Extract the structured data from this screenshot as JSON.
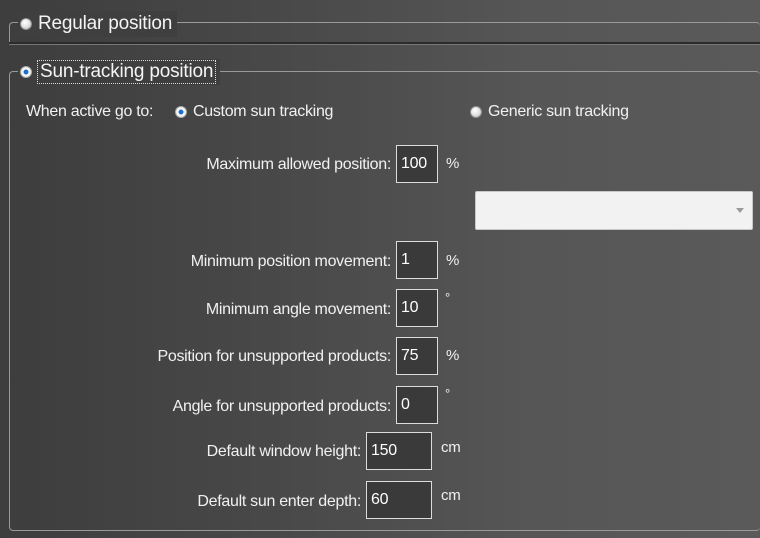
{
  "groups": {
    "regular": {
      "label": "Regular position",
      "selected": false
    },
    "sun": {
      "label": "Sun-tracking position",
      "selected": true
    }
  },
  "active_go_to": {
    "label": "When active go to:",
    "options": [
      {
        "label": "Custom sun tracking",
        "selected": true
      },
      {
        "label": "Generic sun tracking",
        "selected": false
      }
    ]
  },
  "fields": {
    "max_position": {
      "label": "Maximum allowed position:",
      "value": "100",
      "unit": "%"
    },
    "min_position_move": {
      "label": "Minimum position movement:",
      "value": "1",
      "unit": "%"
    },
    "min_angle_move": {
      "label": "Minimum angle movement:",
      "value": "10",
      "unit": "°"
    },
    "pos_unsupported": {
      "label": "Position for unsupported products:",
      "value": "75",
      "unit": "%"
    },
    "angle_unsupported": {
      "label": "Angle for unsupported products:",
      "value": "0",
      "unit": "°"
    },
    "window_height": {
      "label": "Default window height:",
      "value": "150",
      "unit": "cm"
    },
    "sun_enter_depth": {
      "label": "Default sun enter depth:",
      "value": "60",
      "unit": "cm"
    }
  },
  "generic_dropdown": {
    "selected": ""
  },
  "icons": {
    "radio_off": "radio-unselected-icon",
    "radio_on": "radio-selected-icon",
    "dropdown": "chevron-down-icon"
  },
  "colors": {
    "radio_accent": "#1a6fc7",
    "panel_bg": "#4a4a4a",
    "input_border": "#dcdcdc"
  }
}
